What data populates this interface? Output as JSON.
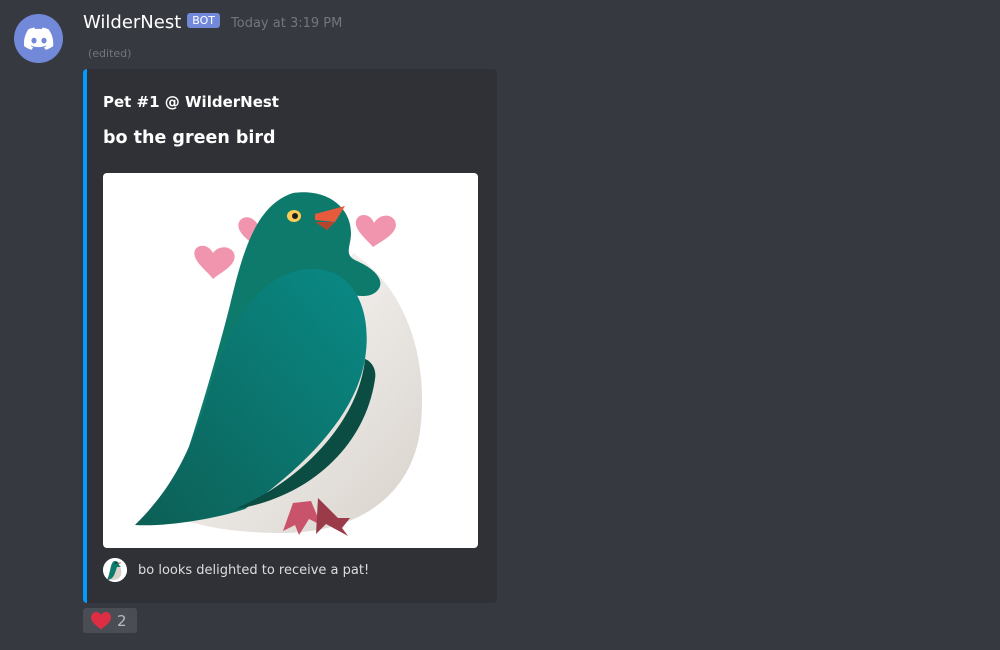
{
  "message": {
    "author": "WilderNest",
    "bot_tag": "BOT",
    "timestamp": "Today at 3:19 PM",
    "edited": "(edited)"
  },
  "embed": {
    "accent_color": "#009cff",
    "author": "Pet #1 @ WilderNest",
    "title": "bo the green bird",
    "image_icon": "green-bird-with-hearts",
    "footer_text": "bo looks delighted to receive a pat!",
    "footer_icon": "green-bird-icon"
  },
  "reactions": [
    {
      "emoji": "red-heart-icon",
      "count": "2"
    }
  ],
  "colors": {
    "background": "#36393f",
    "embed_background": "#2f3136",
    "bot_tag": "#7289da",
    "heart": "#dd2e44"
  }
}
